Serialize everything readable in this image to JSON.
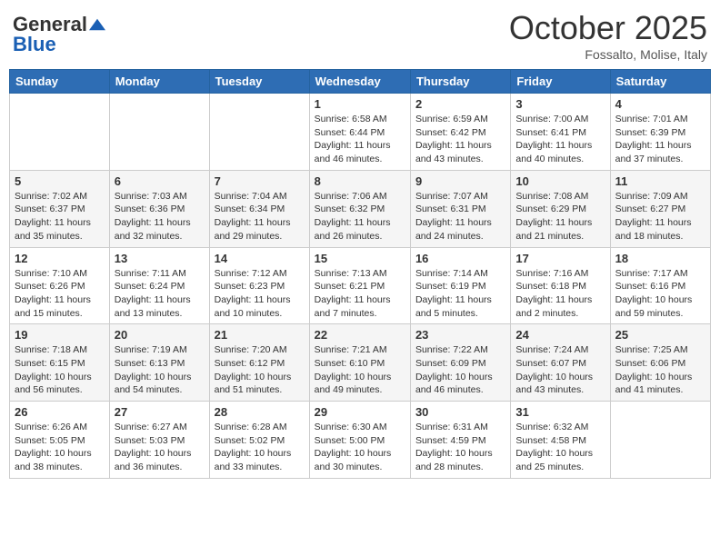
{
  "header": {
    "logo": {
      "general": "General",
      "blue": "Blue"
    },
    "month": "October 2025",
    "location": "Fossalto, Molise, Italy"
  },
  "weekdays": [
    "Sunday",
    "Monday",
    "Tuesday",
    "Wednesday",
    "Thursday",
    "Friday",
    "Saturday"
  ],
  "weeks": [
    [
      {
        "day": "",
        "info": ""
      },
      {
        "day": "",
        "info": ""
      },
      {
        "day": "",
        "info": ""
      },
      {
        "day": "1",
        "info": "Sunrise: 6:58 AM\nSunset: 6:44 PM\nDaylight: 11 hours and 46 minutes."
      },
      {
        "day": "2",
        "info": "Sunrise: 6:59 AM\nSunset: 6:42 PM\nDaylight: 11 hours and 43 minutes."
      },
      {
        "day": "3",
        "info": "Sunrise: 7:00 AM\nSunset: 6:41 PM\nDaylight: 11 hours and 40 minutes."
      },
      {
        "day": "4",
        "info": "Sunrise: 7:01 AM\nSunset: 6:39 PM\nDaylight: 11 hours and 37 minutes."
      }
    ],
    [
      {
        "day": "5",
        "info": "Sunrise: 7:02 AM\nSunset: 6:37 PM\nDaylight: 11 hours and 35 minutes."
      },
      {
        "day": "6",
        "info": "Sunrise: 7:03 AM\nSunset: 6:36 PM\nDaylight: 11 hours and 32 minutes."
      },
      {
        "day": "7",
        "info": "Sunrise: 7:04 AM\nSunset: 6:34 PM\nDaylight: 11 hours and 29 minutes."
      },
      {
        "day": "8",
        "info": "Sunrise: 7:06 AM\nSunset: 6:32 PM\nDaylight: 11 hours and 26 minutes."
      },
      {
        "day": "9",
        "info": "Sunrise: 7:07 AM\nSunset: 6:31 PM\nDaylight: 11 hours and 24 minutes."
      },
      {
        "day": "10",
        "info": "Sunrise: 7:08 AM\nSunset: 6:29 PM\nDaylight: 11 hours and 21 minutes."
      },
      {
        "day": "11",
        "info": "Sunrise: 7:09 AM\nSunset: 6:27 PM\nDaylight: 11 hours and 18 minutes."
      }
    ],
    [
      {
        "day": "12",
        "info": "Sunrise: 7:10 AM\nSunset: 6:26 PM\nDaylight: 11 hours and 15 minutes."
      },
      {
        "day": "13",
        "info": "Sunrise: 7:11 AM\nSunset: 6:24 PM\nDaylight: 11 hours and 13 minutes."
      },
      {
        "day": "14",
        "info": "Sunrise: 7:12 AM\nSunset: 6:23 PM\nDaylight: 11 hours and 10 minutes."
      },
      {
        "day": "15",
        "info": "Sunrise: 7:13 AM\nSunset: 6:21 PM\nDaylight: 11 hours and 7 minutes."
      },
      {
        "day": "16",
        "info": "Sunrise: 7:14 AM\nSunset: 6:19 PM\nDaylight: 11 hours and 5 minutes."
      },
      {
        "day": "17",
        "info": "Sunrise: 7:16 AM\nSunset: 6:18 PM\nDaylight: 11 hours and 2 minutes."
      },
      {
        "day": "18",
        "info": "Sunrise: 7:17 AM\nSunset: 6:16 PM\nDaylight: 10 hours and 59 minutes."
      }
    ],
    [
      {
        "day": "19",
        "info": "Sunrise: 7:18 AM\nSunset: 6:15 PM\nDaylight: 10 hours and 56 minutes."
      },
      {
        "day": "20",
        "info": "Sunrise: 7:19 AM\nSunset: 6:13 PM\nDaylight: 10 hours and 54 minutes."
      },
      {
        "day": "21",
        "info": "Sunrise: 7:20 AM\nSunset: 6:12 PM\nDaylight: 10 hours and 51 minutes."
      },
      {
        "day": "22",
        "info": "Sunrise: 7:21 AM\nSunset: 6:10 PM\nDaylight: 10 hours and 49 minutes."
      },
      {
        "day": "23",
        "info": "Sunrise: 7:22 AM\nSunset: 6:09 PM\nDaylight: 10 hours and 46 minutes."
      },
      {
        "day": "24",
        "info": "Sunrise: 7:24 AM\nSunset: 6:07 PM\nDaylight: 10 hours and 43 minutes."
      },
      {
        "day": "25",
        "info": "Sunrise: 7:25 AM\nSunset: 6:06 PM\nDaylight: 10 hours and 41 minutes."
      }
    ],
    [
      {
        "day": "26",
        "info": "Sunrise: 6:26 AM\nSunset: 5:05 PM\nDaylight: 10 hours and 38 minutes."
      },
      {
        "day": "27",
        "info": "Sunrise: 6:27 AM\nSunset: 5:03 PM\nDaylight: 10 hours and 36 minutes."
      },
      {
        "day": "28",
        "info": "Sunrise: 6:28 AM\nSunset: 5:02 PM\nDaylight: 10 hours and 33 minutes."
      },
      {
        "day": "29",
        "info": "Sunrise: 6:30 AM\nSunset: 5:00 PM\nDaylight: 10 hours and 30 minutes."
      },
      {
        "day": "30",
        "info": "Sunrise: 6:31 AM\nSunset: 4:59 PM\nDaylight: 10 hours and 28 minutes."
      },
      {
        "day": "31",
        "info": "Sunrise: 6:32 AM\nSunset: 4:58 PM\nDaylight: 10 hours and 25 minutes."
      },
      {
        "day": "",
        "info": ""
      }
    ]
  ]
}
